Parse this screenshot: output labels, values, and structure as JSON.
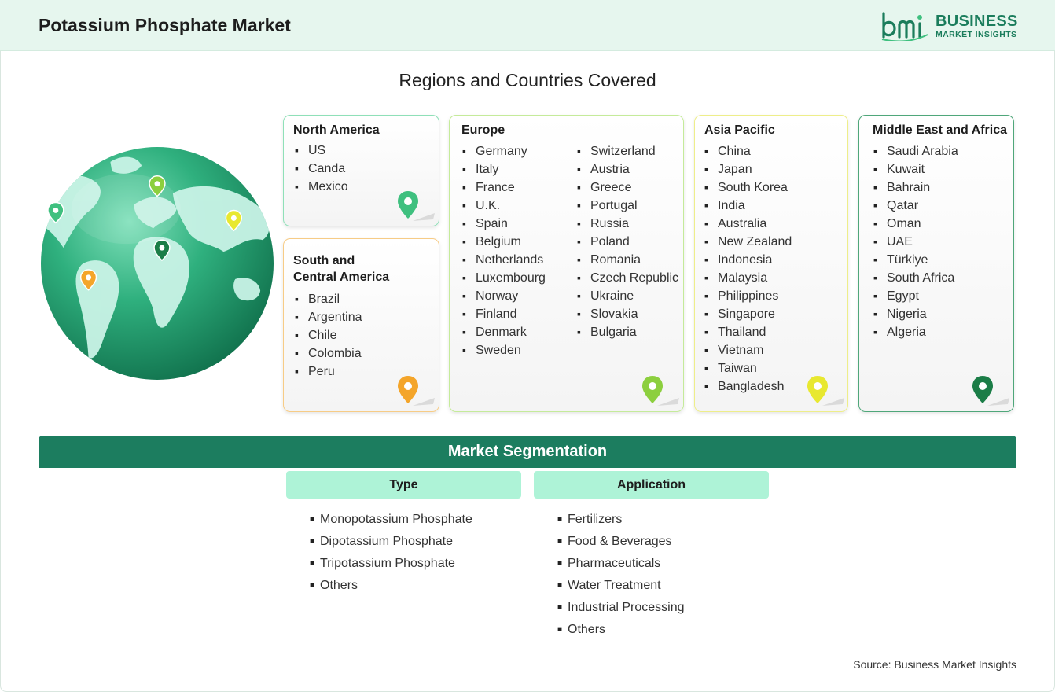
{
  "header": {
    "title": "Potassium Phosphate Market",
    "logo_line1": "BUSINESS",
    "logo_line2": "MARKET INSIGHTS",
    "logo_mark_text": "bmi"
  },
  "regions_title": "Regions and Countries Covered",
  "colors": {
    "brand_green": "#1c7d5f",
    "north_america": "#3fc07f",
    "south_central_america": "#f4a52a",
    "europe": "#8ccf3e",
    "asia_pacific": "#e8e830",
    "middle_east_africa": "#1b7d47",
    "segment_header_bg": "#aef3d7"
  },
  "regions": {
    "north_america": {
      "title": "North America",
      "items": [
        "US",
        "Canda",
        "Mexico"
      ]
    },
    "south_central_america": {
      "title_line1": "South and",
      "title_line2": "Central America",
      "items": [
        "Brazil",
        "Argentina",
        "Chile",
        "Colombia",
        "Peru"
      ]
    },
    "europe": {
      "title": "Europe",
      "col1": [
        "Germany",
        "Italy",
        "France",
        "U.K.",
        "Spain",
        "Belgium",
        "Netherlands",
        "Luxembourg",
        "Norway",
        "Finland",
        "Denmark",
        "Sweden"
      ],
      "col2": [
        "Switzerland",
        "Austria",
        "Greece",
        "Portugal",
        "Russia",
        "Poland",
        "Romania",
        "Czech Republic",
        "Ukraine",
        "Slovakia",
        "Bulgaria"
      ]
    },
    "asia_pacific": {
      "title": "Asia Pacific",
      "items": [
        "China",
        "Japan",
        "South Korea",
        "India",
        "Australia",
        "New Zealand",
        "Indonesia",
        "Malaysia",
        "Philippines",
        "Singapore",
        "Thailand",
        "Vietnam",
        "Taiwan",
        "Bangladesh"
      ]
    },
    "middle_east_africa": {
      "title": "Middle East and Africa",
      "items": [
        "Saudi Arabia",
        "Kuwait",
        "Bahrain",
        "Qatar",
        "Oman",
        "UAE",
        "Türkiye",
        "South Africa",
        "Egypt",
        "Nigeria",
        "Algeria"
      ]
    }
  },
  "segmentation": {
    "title": "Market Segmentation",
    "type": {
      "header": "Type",
      "items": [
        "Monopotassium Phosphate",
        "Dipotassium Phosphate",
        "Tripotassium Phosphate",
        "Others"
      ]
    },
    "application": {
      "header": "Application",
      "items": [
        "Fertilizers",
        "Food & Beverages",
        "Pharmaceuticals",
        "Water Treatment",
        "Industrial Processing",
        "Others"
      ]
    }
  },
  "source": "Source: Business Market Insights"
}
